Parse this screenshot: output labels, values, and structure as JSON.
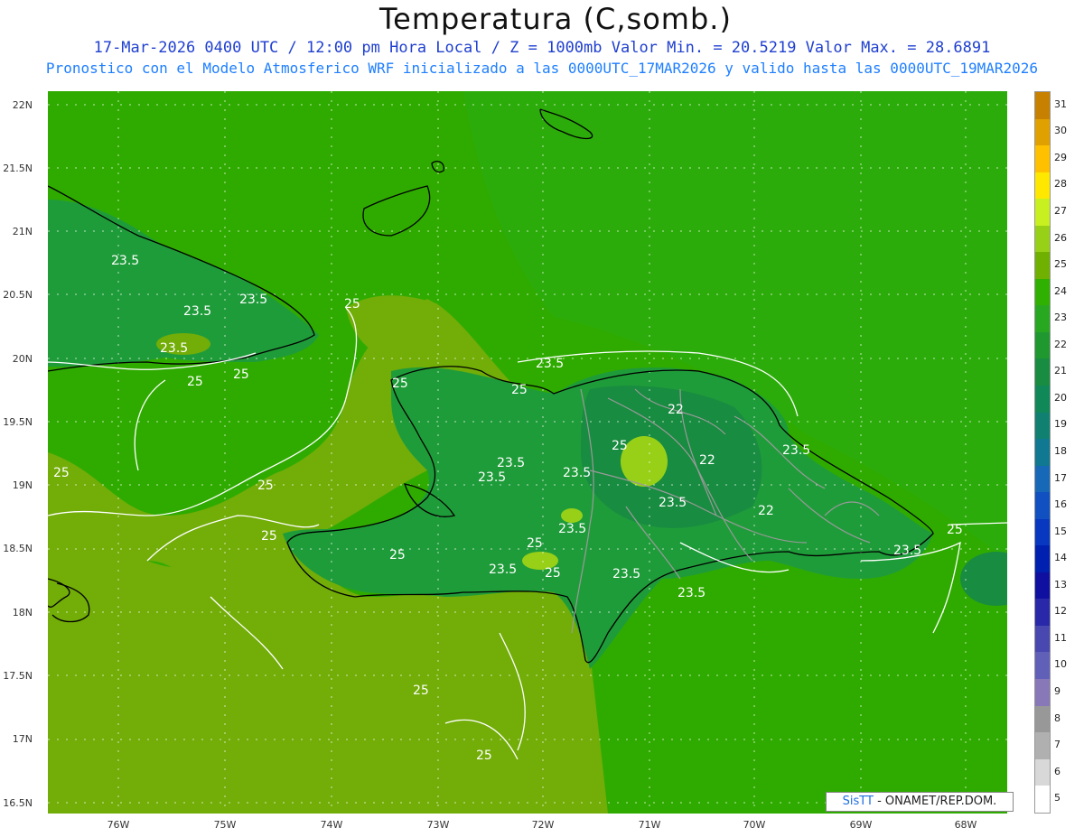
{
  "header": {
    "title": "Temperatura (C,somb.)",
    "subtitle_line1": "17-Mar-2026 0400 UTC / 12:00 pm Hora Local / Z = 1000mb   Valor Min. = 20.5219  Valor Max. = 28.6891",
    "subtitle_line2": "Pronostico con el Modelo Atmosferico WRF inicializado a las 0000UTC_17MAR2026 y valido hasta las  0000UTC_19MAR2026"
  },
  "axes": {
    "lat_labels": [
      "22N",
      "21.5N",
      "21N",
      "20.5N",
      "20N",
      "19.5N",
      "19N",
      "18.5N",
      "18N",
      "17.5N",
      "17N",
      "16.5N"
    ],
    "lon_labels": [
      "76W",
      "75W",
      "74W",
      "73W",
      "72W",
      "71W",
      "70W",
      "69W",
      "68W"
    ]
  },
  "contour_labels": [
    "23.5",
    "23.5",
    "23.5",
    "23.5",
    "25",
    "25",
    "25",
    "25",
    "25",
    "25",
    "23.5",
    "25",
    "22",
    "25",
    "23.5",
    "23.5",
    "23.5",
    "25",
    "22",
    "23.5",
    "22",
    "23.5",
    "25",
    "23.5",
    "25",
    "23.5",
    "25",
    "23.5",
    "25",
    "23.5",
    "23.5",
    "25",
    "25"
  ],
  "colorbar": {
    "levels": [
      "31",
      "30",
      "29",
      "28",
      "27",
      "26",
      "25",
      "24",
      "23",
      "22",
      "21",
      "20",
      "19",
      "18",
      "17",
      "16",
      "15",
      "14",
      "13",
      "12",
      "11",
      "10",
      "9",
      "8",
      "7",
      "6",
      "5"
    ],
    "colors": [
      "#c88000",
      "#e0a000",
      "#ffc000",
      "#ffe800",
      "#c8f020",
      "#98d018",
      "#70b000",
      "#30b000",
      "#28a820",
      "#209830",
      "#188c40",
      "#108858",
      "#108070",
      "#107890",
      "#1868b8",
      "#1050c0",
      "#0838c0",
      "#0020b0",
      "#1010a0",
      "#2828a8",
      "#4848b0",
      "#6060b8",
      "#8878b8",
      "#989898",
      "#b0b0b0",
      "#d8d8d8",
      "#ffffff"
    ]
  },
  "credit": {
    "brand": "SisTT",
    "text": "- ONAMET/REP.DOM."
  },
  "colors": {
    "sea": "#2fab00",
    "land_warm": "#72ad08",
    "land_cool": "#1f9c3a",
    "title_blue": "#1f3fcf",
    "subtitle_blue": "#1f7fff"
  }
}
